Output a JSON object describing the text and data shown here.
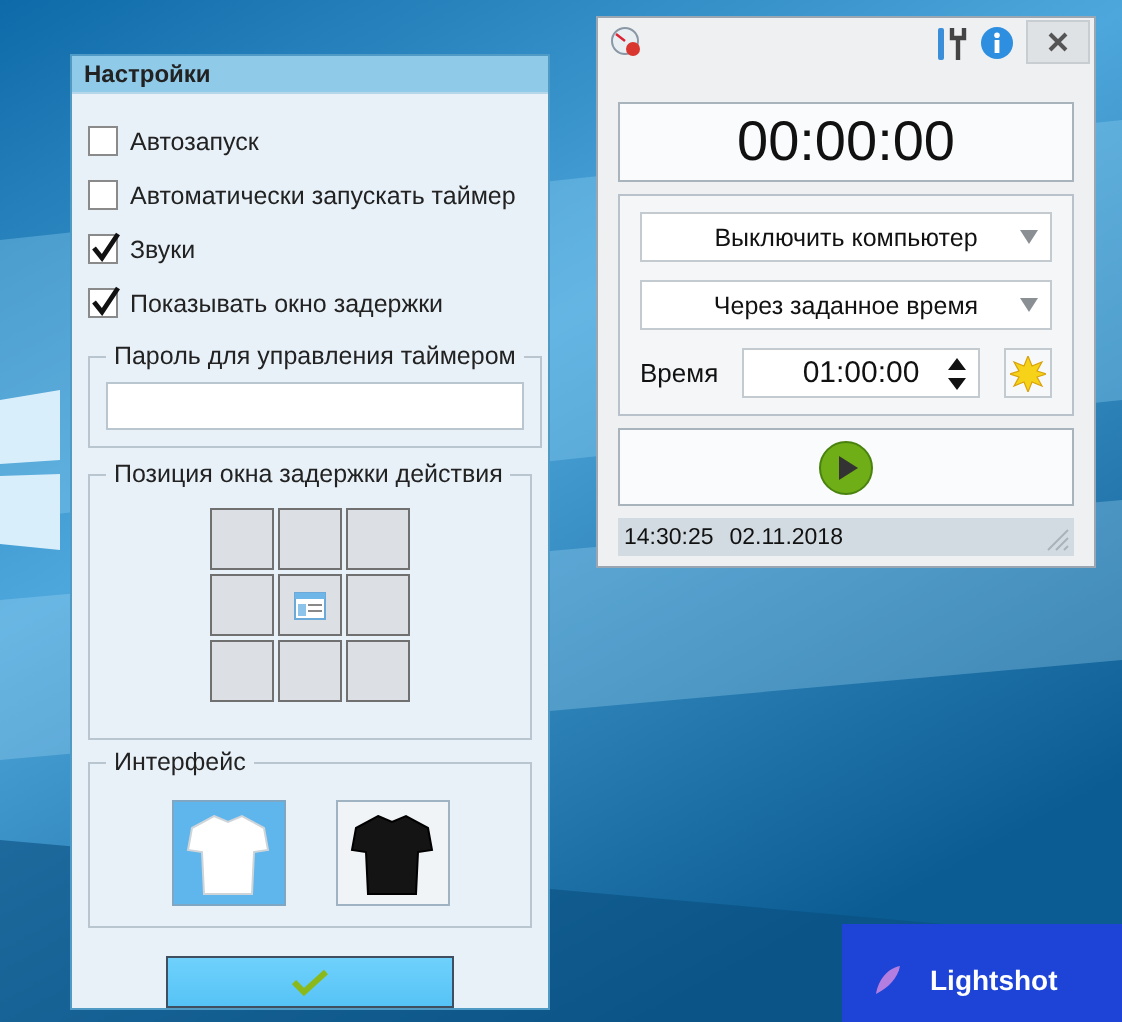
{
  "settings": {
    "title": "Настройки",
    "options": [
      {
        "label": "Автозапуск",
        "checked": false
      },
      {
        "label": "Автоматически запускать таймер",
        "checked": false
      },
      {
        "label": "Звуки",
        "checked": true
      },
      {
        "label": "Показывать окно задержки",
        "checked": true
      }
    ],
    "password": {
      "title": "Пароль для управления таймером"
    },
    "position": {
      "title": "Позиция окна задержки действия",
      "cells": [
        {
          "selected": false
        },
        {
          "selected": false
        },
        {
          "selected": false
        },
        {
          "selected": false
        },
        {
          "selected": true
        },
        {
          "selected": false
        },
        {
          "selected": false
        },
        {
          "selected": false
        },
        {
          "selected": false
        }
      ]
    },
    "interface": {
      "title": "Интерфейс",
      "themes": [
        {
          "kind": "light",
          "selected": true
        },
        {
          "kind": "dark",
          "selected": false
        }
      ]
    }
  },
  "timer": {
    "countdown": "00:00:00",
    "action": "Выключить компьютер",
    "mode": "Через заданное время",
    "time_label": "Время",
    "time_value": "01:00:00",
    "status_time": "14:30:25",
    "status_date": "02.11.2018"
  },
  "notification": {
    "title": "Lightshot"
  }
}
